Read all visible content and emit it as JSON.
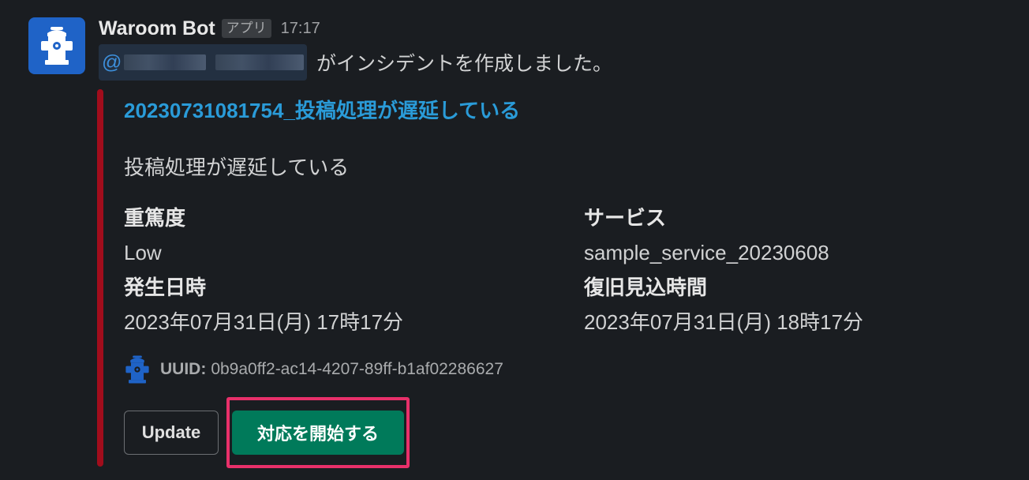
{
  "message": {
    "bot_name": "Waroom Bot",
    "app_badge": "アプリ",
    "time": "17:17",
    "mention_prefix": "@",
    "intro_text": "がインシデントを作成しました。"
  },
  "attachment": {
    "accent_color": "#a10d1c",
    "title": "20230731081754_投稿処理が遅延している",
    "description": "投稿処理が遅延している",
    "fields": {
      "severity": {
        "label": "重篤度",
        "value": "Low"
      },
      "service": {
        "label": "サービス",
        "value": "sample_service_20230608"
      },
      "occurred_at": {
        "label": "発生日時",
        "value": "2023年07月31日(月) 17時17分"
      },
      "expected_recovery": {
        "label": "復旧見込時間",
        "value": "2023年07月31日(月) 18時17分"
      }
    },
    "footer": {
      "icon": "fire-hydrant-icon",
      "uuid_label": "UUID:",
      "uuid_value": "0b9a0ff2-ac14-4207-89ff-b1af02286627"
    }
  },
  "actions": {
    "update_label": "Update",
    "start_label": "対応を開始する",
    "start_color": "#007a5a",
    "highlight_color": "#e8306a"
  },
  "avatar": {
    "icon": "fire-hydrant-icon",
    "background": "#1f63c7"
  }
}
